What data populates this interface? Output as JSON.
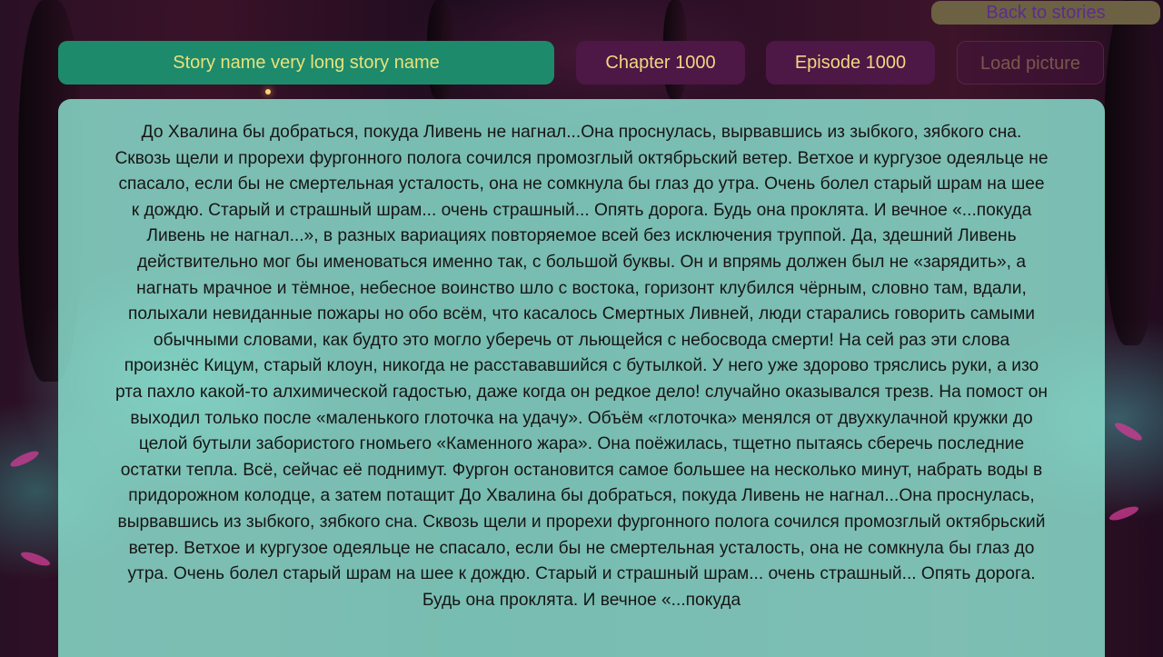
{
  "header": {
    "back_label": "Back to stories"
  },
  "top_bar": {
    "story_name": "Story name very long story name",
    "chapter": "Chapter 1000",
    "episode": "Episode 1000",
    "load_picture": "Load picture"
  },
  "story": {
    "text": "До Хвалина бы добраться, покуда Ливень не нагнал...Она проснулась, вырвавшись из зыбкого, зябкого сна. Сквозь щели и прорехи фургонного полога сочился промозглый октябрьский ветер. Ветхое и кургузое одеяльце не спасало, если бы не смертельная усталость, она не сомкнула бы глаз до утра. Очень болел старый шрам на шее к дождю. Старый и страшный шрам... очень страшный... Опять дорога. Будь она проклята. И вечное «...покуда Ливень не нагнал...», в разных вариациях повторяемое всей без исключения труппой. Да, здешний Ливень действительно мог бы именоваться именно так, с большой буквы. Он и впрямь должен был не «зарядить», а нагнать мрачное и тёмное, небесное воинство шло с востока, горизонт клубился чёрным, словно там, вдали, полыхали невиданные пожары но обо всём, что касалось Смертных Ливней, люди старались говорить самыми обычными словами, как будто это могло уберечь от льющейся с небосвода смерти! На сей раз эти слова произнёс Кицум, старый клоун, никогда не расстававшийся с бутылкой. У него уже здорово тряслись руки, а изо рта пахло какой-то алхимической гадостью, даже когда он редкое дело! случайно оказывался трезв. На помост он выходил только после «маленького глоточка на удачу». Объём «глоточка» менялся от двухкулачной кружки до целой бутыли забористого гномьего «Каменного жара». Она поёжилась, тщетно пытаясь сберечь последние остатки тепла. Всё, сейчас её поднимут. Фургон остановится самое большее на несколько минут, набрать воды в придорожном колодце, а затем потащит До Хвалина бы добраться, покуда Ливень не нагнал...Она проснулась, вырвавшись из зыбкого, зябкого сна. Сквозь щели и прорехи фургонного полога сочился промозглый октябрьский ветер. Ветхое и кургузое одеяльце не спасало, если бы не смертельная усталость, она не сомкнула бы глаз до утра. Очень болел старый шрам на шее к дождю. Старый и страшный шрам... очень страшный... Опять дорога. Будь она проклята. И вечное «...покуда"
  },
  "colors": {
    "story_name_bg": "#1e8a6c",
    "chapter_bg": "#4d1746",
    "accent_text": "#f0d780",
    "panel_bg": "#8ce4d2"
  }
}
